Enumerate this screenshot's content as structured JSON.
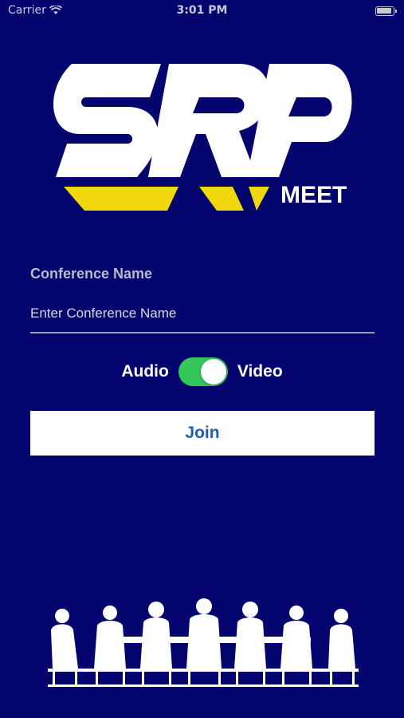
{
  "status_bar": {
    "carrier": "Carrier",
    "time": "3:01 PM"
  },
  "logo": {
    "letters": "SRP",
    "sub": "MEET"
  },
  "form": {
    "conference_label": "Conference Name",
    "conference_placeholder": "Enter Conference Name",
    "conference_value": ""
  },
  "mode": {
    "left_label": "Audio",
    "right_label": "Video",
    "toggle_on": true
  },
  "join_label": "Join",
  "colors": {
    "background": "#03046e",
    "logo_yellow": "#f2d70c",
    "toggle_on": "#34c759",
    "join_text": "#1b60b3"
  },
  "icons": [
    "wifi-icon",
    "battery-icon",
    "meeting-silhouette-icon"
  ]
}
